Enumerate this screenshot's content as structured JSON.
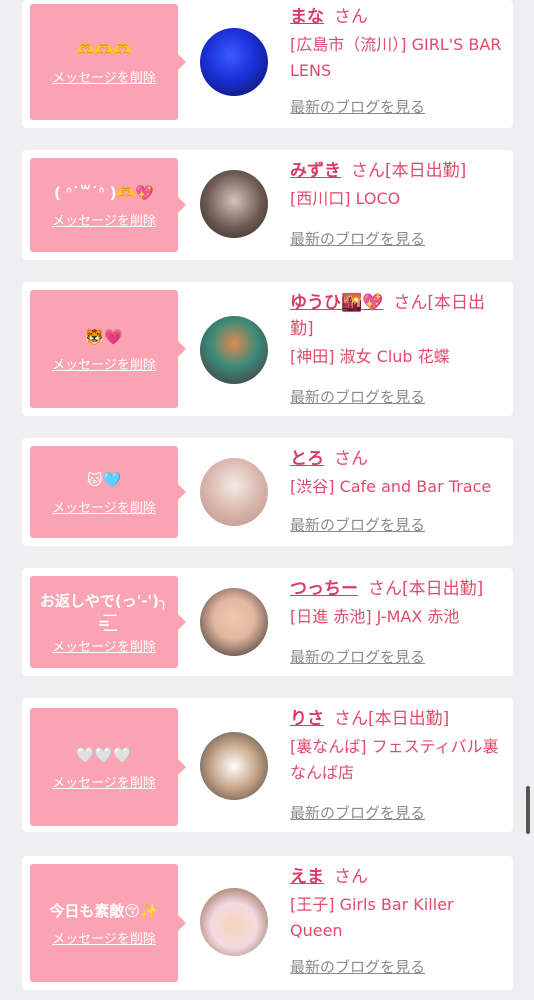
{
  "common": {
    "delete_label": "メッセージを削除",
    "blog_link": "最新のブログを見る",
    "san": "さん"
  },
  "messages": [
    {
      "message": "🫶🫶🫶",
      "name": "まな",
      "status": "",
      "shop": "[広島市（流川）] GIRL'S BAR LENS",
      "avatar_colors": [
        "#1a2fd6",
        "#0a1250"
      ]
    },
    {
      "message": "( ᐢ˙꒳​˙ᐢ )🫶💖",
      "name": "みずき",
      "status": "[本日出勤]",
      "shop": "[西川口] LOCO",
      "avatar_colors": [
        "#6b5a52",
        "#2e2420"
      ]
    },
    {
      "message": "🐯💗",
      "name": "ゆうひ🌇💖",
      "status": "[本日出勤]",
      "shop": "[神田] 淑女 Club 花蝶",
      "avatar_colors": [
        "#3a8a7a",
        "#4a2a30"
      ]
    },
    {
      "message": "🐱🩵",
      "name": "とろ",
      "status": "",
      "shop": "[渋谷] Cafe and Bar Trace",
      "avatar_colors": [
        "#f3ebe6",
        "#b9918a"
      ]
    },
    {
      "message": "お返しやで(っ'-')╮ =͟͟͞",
      "name": "つっちー",
      "status": "[本日出勤]",
      "shop": "[日進 赤池] J-MAX 赤池",
      "avatar_colors": [
        "#e3b7a0",
        "#222222"
      ]
    },
    {
      "message": "🤍🤍🤍",
      "name": "りさ",
      "status": "[本日出勤]",
      "shop": "[裏なんば] フェスティバル裏なんば店",
      "avatar_colors": [
        "#c9a98e",
        "#4b3b30"
      ]
    },
    {
      "message": "今日も素敵😚✨",
      "name": "えま",
      "status": "",
      "shop": "[王子] Girls Bar Killer Queen",
      "avatar_colors": [
        "#f3d9e2",
        "#7a4c2a"
      ]
    }
  ]
}
